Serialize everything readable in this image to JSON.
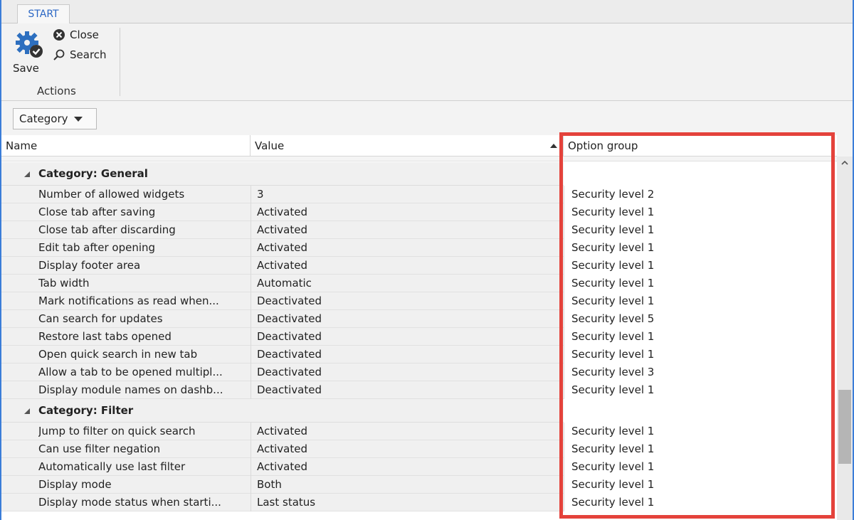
{
  "ribbon": {
    "tab_label": "START",
    "save_label": "Save",
    "close_label": "Close",
    "search_label": "Search",
    "group_label": "Actions"
  },
  "toolbar": {
    "category_dropdown": "Category"
  },
  "grid": {
    "columns": [
      "Name",
      "Value",
      "Option group"
    ],
    "categories": [
      {
        "label": "Category: General",
        "rows": [
          {
            "name": "Number of allowed widgets",
            "value": "3",
            "group": "Security level 2"
          },
          {
            "name": "Close tab after saving",
            "value": "Activated",
            "group": "Security level 1"
          },
          {
            "name": "Close tab after discarding",
            "value": "Activated",
            "group": "Security level 1"
          },
          {
            "name": "Edit tab after opening",
            "value": "Activated",
            "group": "Security level 1"
          },
          {
            "name": "Display footer area",
            "value": "Activated",
            "group": "Security level 1"
          },
          {
            "name": "Tab width",
            "value": "Automatic",
            "group": "Security level 1"
          },
          {
            "name": "Mark notifications as read when...",
            "value": "Deactivated",
            "group": "Security level 1"
          },
          {
            "name": "Can search for updates",
            "value": "Deactivated",
            "group": "Security level 5"
          },
          {
            "name": "Restore last tabs opened",
            "value": "Deactivated",
            "group": "Security level 1"
          },
          {
            "name": "Open quick search in new tab",
            "value": "Deactivated",
            "group": "Security level 1"
          },
          {
            "name": "Allow a tab to be opened multipl...",
            "value": "Deactivated",
            "group": "Security level 3"
          },
          {
            "name": "Display module names on dashb...",
            "value": "Deactivated",
            "group": "Security level 1"
          }
        ]
      },
      {
        "label": "Category: Filter",
        "rows": [
          {
            "name": "Jump to filter on quick search",
            "value": "Activated",
            "group": "Security level 1"
          },
          {
            "name": "Can use filter negation",
            "value": "Activated",
            "group": "Security level 1"
          },
          {
            "name": "Automatically use last filter",
            "value": "Activated",
            "group": "Security level 1"
          },
          {
            "name": "Display mode",
            "value": "Both",
            "group": "Security level 1"
          },
          {
            "name": "Display mode status when starti...",
            "value": "Last status",
            "group": "Security level 1"
          }
        ]
      }
    ]
  },
  "colors": {
    "accent": "#2a66c4",
    "highlight": "#e4423b"
  }
}
